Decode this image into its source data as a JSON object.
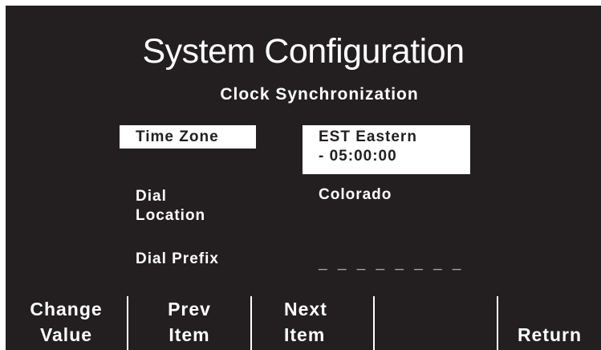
{
  "screen": {
    "title": "System Configuration",
    "subtitle": "Clock Synchronization"
  },
  "fields": {
    "time_zone": {
      "label": "Time Zone",
      "value_line1": "EST Eastern",
      "value_line2": "- 05:00:00",
      "selected": true
    },
    "dial_location": {
      "label_line1": "Dial",
      "label_line2": "Location",
      "value": "Colorado"
    },
    "dial_prefix": {
      "label": "Dial Prefix",
      "value": "________"
    }
  },
  "softkeys": {
    "change_value": {
      "line1": "Change",
      "line2": "Value"
    },
    "prev_item": {
      "line1": "Prev",
      "line2": "Item"
    },
    "next_item": {
      "line1": "Next",
      "line2": "Item"
    },
    "blank": {
      "line1": "",
      "line2": ""
    },
    "return": {
      "line1": "",
      "line2": "Return"
    }
  },
  "colors": {
    "background": "#231f20",
    "foreground": "#ffffff",
    "border": "#ffffff"
  }
}
